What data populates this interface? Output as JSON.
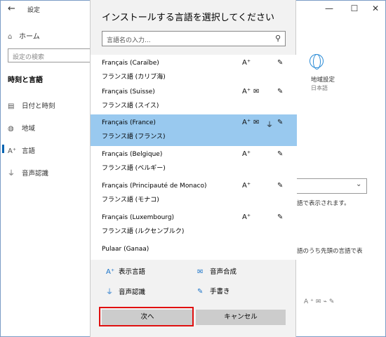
{
  "settings": {
    "back_glyph": "←",
    "app_title": "設定",
    "window_controls": {
      "minimize": "—",
      "maximize": "☐",
      "close": "✕"
    },
    "home_label": "ホーム",
    "search_placeholder": "設定の検索",
    "section_title": "時刻と言語",
    "nav_items": [
      {
        "label": "日付と時刻",
        "icon": "calendar-clock-icon",
        "glyph": "▤"
      },
      {
        "label": "地域",
        "icon": "region-icon",
        "glyph": "◍"
      },
      {
        "label": "言語",
        "icon": "language-icon",
        "glyph": "A⁺"
      },
      {
        "label": "音声認識",
        "icon": "microphone-icon",
        "glyph": "⏚"
      }
    ],
    "right_pane": {
      "region_label": "地域設定",
      "region_sub": "日本語",
      "text1": "語で表示されます。",
      "text2": "語のうち先頭の言語で表"
    }
  },
  "dialog": {
    "title": "インストールする言語を選択してください",
    "search_placeholder": "言語名の入力...",
    "languages": [
      {
        "name": "Français (Caraïbe)",
        "sub": "フランス語 (カリブ海)",
        "selected": false,
        "features": [
          "display",
          "handwriting"
        ]
      },
      {
        "name": "Français (Suisse)",
        "sub": "フランス語 (スイス)",
        "selected": false,
        "features": [
          "display",
          "tts",
          "handwriting"
        ]
      },
      {
        "name": "Français (France)",
        "sub": "フランス語 (フランス)",
        "selected": true,
        "features": [
          "display",
          "tts",
          "speech",
          "handwriting"
        ]
      },
      {
        "name": "Français (Belgique)",
        "sub": "フランス語 (ベルギー)",
        "selected": false,
        "features": [
          "display",
          "handwriting"
        ]
      },
      {
        "name": "Français (Principauté de Monaco)",
        "sub": "フランス語 (モナコ)",
        "selected": false,
        "features": [
          "display",
          "handwriting"
        ]
      },
      {
        "name": "Français (Luxembourg)",
        "sub": "フランス語 (ルクセンブルク)",
        "selected": false,
        "features": [
          "display",
          "handwriting"
        ]
      },
      {
        "name": "Pulaar (Ganaa)",
        "sub": "",
        "selected": false,
        "features": []
      }
    ],
    "legend": {
      "display": "表示言語",
      "tts": "音声合成",
      "speech": "音声認識",
      "handwriting": "手書き"
    },
    "next_label": "次へ",
    "cancel_label": "キャンセル"
  },
  "colors": {
    "selected_row": "#99c9ef",
    "dialog_bg": "#f2f2f2",
    "button_bg": "#cccccc",
    "highlight_box": "#e01010",
    "accent": "#0063b1"
  }
}
